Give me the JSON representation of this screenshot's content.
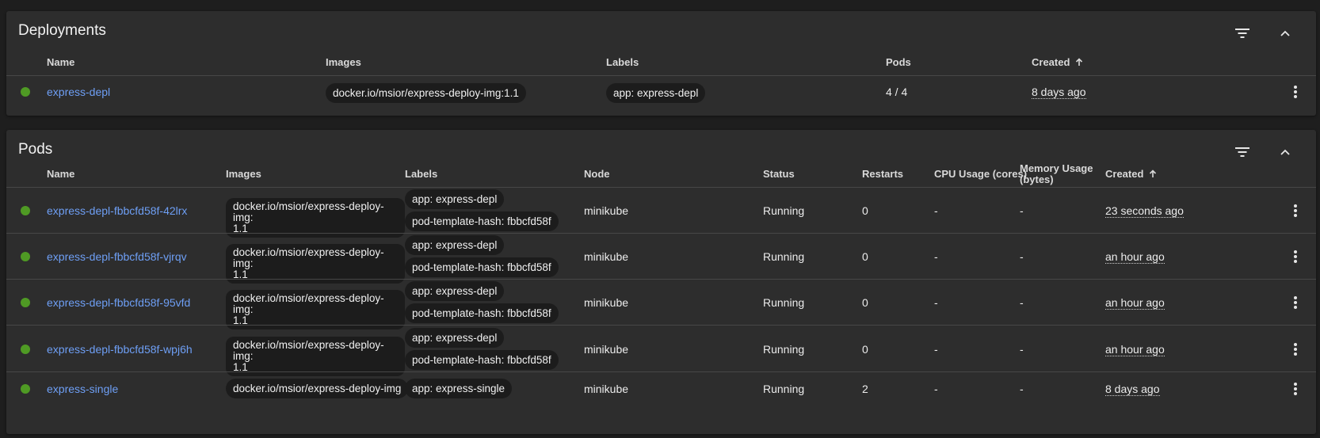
{
  "deployments": {
    "title": "Deployments",
    "columns": {
      "name": "Name",
      "images": "Images",
      "labels": "Labels",
      "pods": "Pods",
      "created": "Created"
    },
    "rows": [
      {
        "name": "express-depl",
        "image": "docker.io/msior/express-deploy-img:1.1",
        "label": "app: express-depl",
        "pods": "4 / 4",
        "created": "8 days ago",
        "status_color": "#4f9a24"
      }
    ]
  },
  "pods": {
    "title": "Pods",
    "columns": {
      "name": "Name",
      "images": "Images",
      "labels": "Labels",
      "node": "Node",
      "status": "Status",
      "restarts": "Restarts",
      "cpu": "CPU Usage (cores)",
      "memory": "Memory Usage (bytes)",
      "created": "Created"
    },
    "rows": [
      {
        "name": "express-depl-fbbcfd58f-42lrx",
        "image": "docker.io/msior/express-deploy-img:\n1.1",
        "label1": "app: express-depl",
        "label2": "pod-template-hash: fbbcfd58f",
        "node": "minikube",
        "status": "Running",
        "restarts": "0",
        "cpu": "-",
        "memory": "-",
        "created": "23 seconds ago"
      },
      {
        "name": "express-depl-fbbcfd58f-vjrqv",
        "image": "docker.io/msior/express-deploy-img:\n1.1",
        "label1": "app: express-depl",
        "label2": "pod-template-hash: fbbcfd58f",
        "node": "minikube",
        "status": "Running",
        "restarts": "0",
        "cpu": "-",
        "memory": "-",
        "created": "an hour ago"
      },
      {
        "name": "express-depl-fbbcfd58f-95vfd",
        "image": "docker.io/msior/express-deploy-img:\n1.1",
        "label1": "app: express-depl",
        "label2": "pod-template-hash: fbbcfd58f",
        "node": "minikube",
        "status": "Running",
        "restarts": "0",
        "cpu": "-",
        "memory": "-",
        "created": "an hour ago"
      },
      {
        "name": "express-depl-fbbcfd58f-wpj6h",
        "image": "docker.io/msior/express-deploy-img:\n1.1",
        "label1": "app: express-depl",
        "label2": "pod-template-hash: fbbcfd58f",
        "node": "minikube",
        "status": "Running",
        "restarts": "0",
        "cpu": "-",
        "memory": "-",
        "created": "an hour ago"
      },
      {
        "name": "express-single",
        "image": "docker.io/msior/express-deploy-img",
        "label1": "app: express-single",
        "node": "minikube",
        "status": "Running",
        "restarts": "2",
        "cpu": "-",
        "memory": "-",
        "created": "8 days ago"
      }
    ]
  },
  "icons": {
    "filter": "filter-icon",
    "collapse": "chevron-up-icon",
    "sort": "arrow-up-icon",
    "menu": "more-vert-icon"
  },
  "colors": {
    "link": "#6e9ff5",
    "status_ok": "#4f9a24",
    "card": "#2d2d2d",
    "background": "#1e1e1e"
  }
}
